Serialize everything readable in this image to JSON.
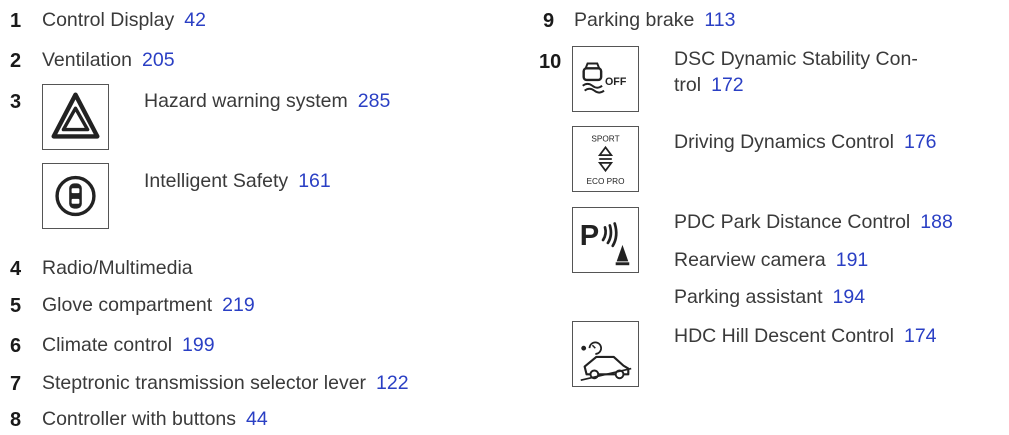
{
  "left_items": [
    {
      "num": "1",
      "label": "Control Display",
      "page": "42"
    },
    {
      "num": "2",
      "label": "Ventilation",
      "page": "205"
    },
    {
      "num": "3",
      "sub": [
        {
          "label": "Hazard warning system",
          "page": "285",
          "icon": "hazard-triangle-icon"
        },
        {
          "label": "Intelligent Safety",
          "page": "161",
          "icon": "intelligent-safety-icon"
        }
      ]
    },
    {
      "num": "4",
      "label": "Radio/Multimedia",
      "page": ""
    },
    {
      "num": "5",
      "label": "Glove compartment",
      "page": "219"
    },
    {
      "num": "6",
      "label": "Climate control",
      "page": "199"
    },
    {
      "num": "7",
      "label": "Steptronic transmission selector lever",
      "page": "122"
    },
    {
      "num": "8",
      "label": "Controller with buttons",
      "page": "44"
    }
  ],
  "right_items": [
    {
      "num": "9",
      "label": "Parking brake",
      "page": "113"
    },
    {
      "num": "10",
      "sub": [
        {
          "label_line1": "DSC Dynamic Stability Con-",
          "label_line2": "trol",
          "page": "172",
          "icon": "dsc-off-icon",
          "icon_text": "OFF"
        },
        {
          "label": "Driving Dynamics Control",
          "page": "176",
          "icon": "sport-ecopro-icon",
          "icon_text_top": "SPORT",
          "icon_text_bottom": "ECO PRO"
        },
        {
          "label": "PDC Park Distance Control",
          "page": "188",
          "icon": "pdc-icon",
          "icon_text": "P"
        },
        {
          "label": "Rearview camera",
          "page": "191"
        },
        {
          "label": "Parking assistant",
          "page": "194"
        },
        {
          "label": "HDC Hill Descent Control",
          "page": "174",
          "icon": "hdc-icon"
        }
      ]
    }
  ],
  "colors": {
    "text": "#3a3a3a",
    "number": "#1a1a1a",
    "page_ref": "#2a3fc4",
    "icon_border": "#555555"
  }
}
